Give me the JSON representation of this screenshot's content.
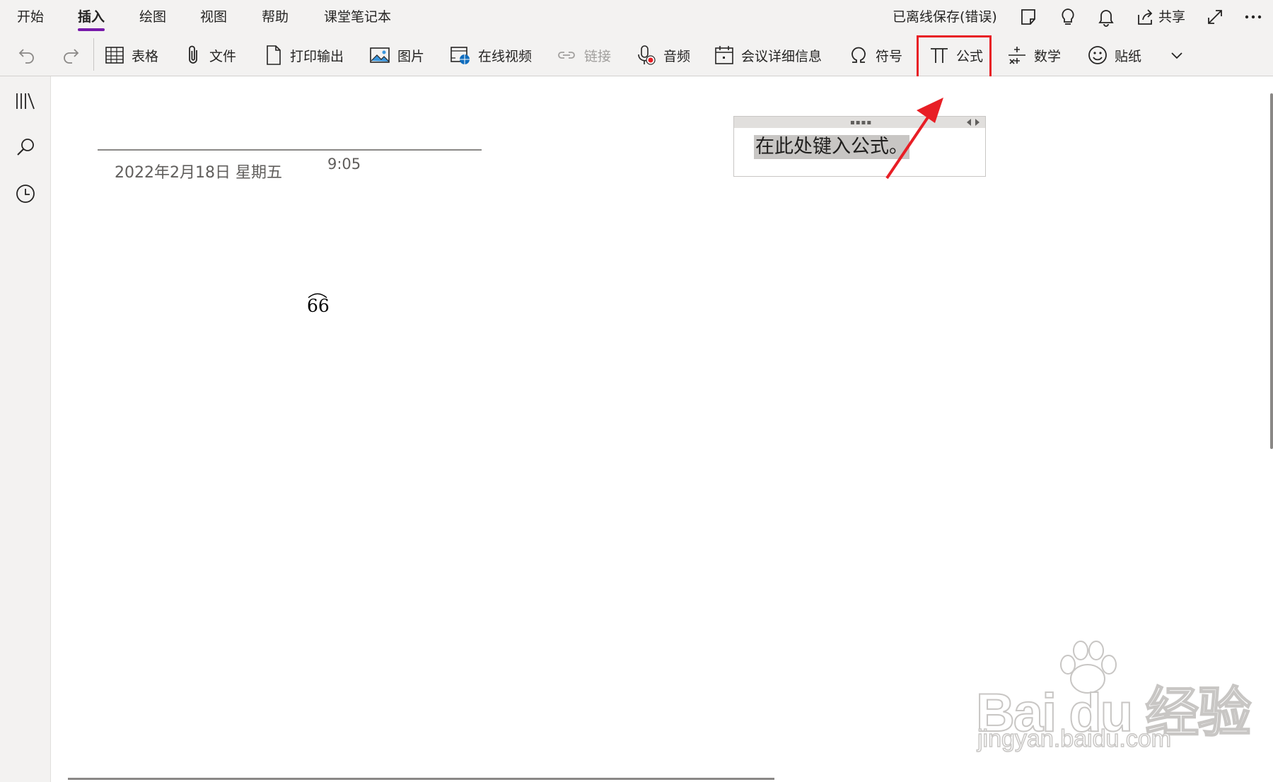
{
  "menu": {
    "tabs": [
      {
        "label": "开始"
      },
      {
        "label": "插入"
      },
      {
        "label": "绘图"
      },
      {
        "label": "视图"
      },
      {
        "label": "帮助"
      },
      {
        "label": "课堂笔记本"
      }
    ],
    "active_tab": "插入",
    "save_status": "已离线保存(错误)",
    "share_label": "共享",
    "icons": [
      "notes-icon",
      "lightbulb-icon",
      "bell-icon",
      "share-icon",
      "expand-icon",
      "more-icon"
    ]
  },
  "ribbon": {
    "undo_icon": "undo-icon",
    "redo_icon": "redo-icon",
    "table_label": "表格",
    "file_label": "文件",
    "printout_label": "打印输出",
    "picture_label": "图片",
    "online_video_label": "在线视频",
    "link_label": "链接",
    "audio_label": "音频",
    "meeting_details_label": "会议详细信息",
    "symbol_label": "符号",
    "equation_label": "公式",
    "math_label": "数学",
    "sticker_label": "贴纸",
    "overflow_icon": "chevron-down-icon"
  },
  "left_rail": {
    "icons": [
      "notebooks-icon",
      "search-icon",
      "recent-clock-icon"
    ]
  },
  "page": {
    "date": "2022年2月18日 星期五",
    "time": "9:05",
    "math_content": "66"
  },
  "equation_box": {
    "placeholder": "在此处键入公式。"
  },
  "watermark": {
    "line1": "Bai du 经验",
    "line2": "jingyan.baidu.com"
  },
  "colors": {
    "accent": "#7719aa",
    "highlight": "#e81e25",
    "chrome": "#f3f2f1"
  }
}
